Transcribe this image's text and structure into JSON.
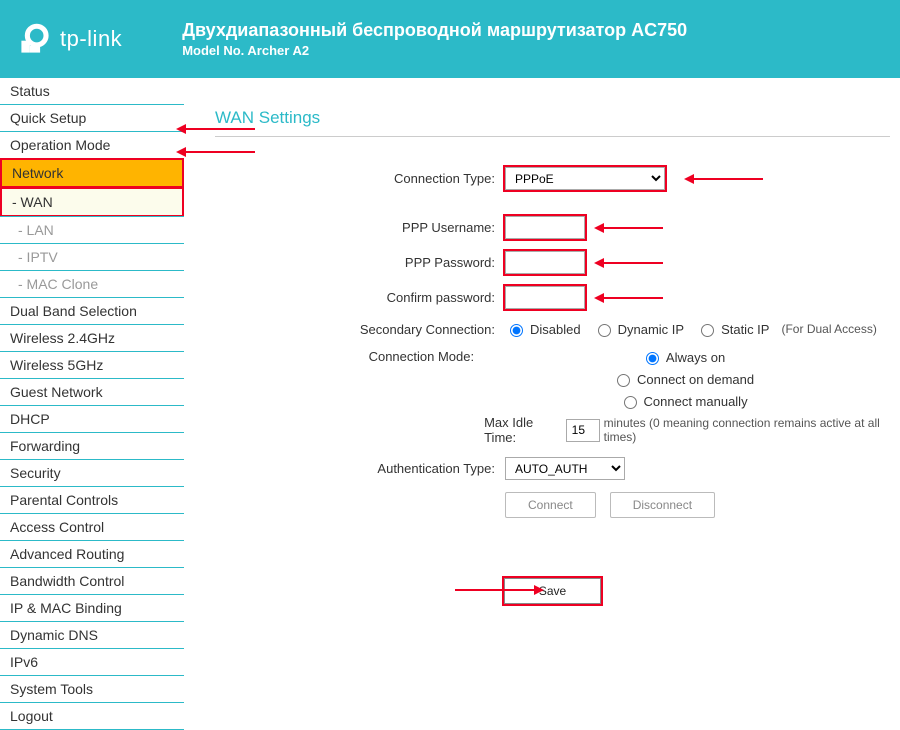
{
  "header": {
    "brand": "tp-link",
    "title": "Двухдиапазонный беспроводной маршрутизатор AC750",
    "subtitle": "Model No. Archer A2"
  },
  "sidebar": {
    "items": [
      {
        "label": "Status"
      },
      {
        "label": "Quick Setup"
      },
      {
        "label": "Operation Mode"
      },
      {
        "label": "Network"
      },
      {
        "label": "- WAN"
      },
      {
        "label": "- LAN"
      },
      {
        "label": "- IPTV"
      },
      {
        "label": "- MAC Clone"
      },
      {
        "label": "Dual Band Selection"
      },
      {
        "label": "Wireless 2.4GHz"
      },
      {
        "label": "Wireless 5GHz"
      },
      {
        "label": "Guest Network"
      },
      {
        "label": "DHCP"
      },
      {
        "label": "Forwarding"
      },
      {
        "label": "Security"
      },
      {
        "label": "Parental Controls"
      },
      {
        "label": "Access Control"
      },
      {
        "label": "Advanced Routing"
      },
      {
        "label": "Bandwidth Control"
      },
      {
        "label": "IP & MAC Binding"
      },
      {
        "label": "Dynamic DNS"
      },
      {
        "label": "IPv6"
      },
      {
        "label": "System Tools"
      },
      {
        "label": "Logout"
      }
    ]
  },
  "page": {
    "title": "WAN Settings",
    "labels": {
      "connection_type": "Connection Type:",
      "ppp_username": "PPP Username:",
      "ppp_password": "PPP Password:",
      "confirm_password": "Confirm password:",
      "secondary_connection": "Secondary Connection:",
      "connection_mode": "Connection Mode:",
      "max_idle": "Max Idle Time:",
      "minutes_note": "minutes (0 meaning connection remains active at all times)",
      "auth_type": "Authentication Type:"
    },
    "values": {
      "connection_type": "PPPoE",
      "ppp_username": "",
      "ppp_password": "",
      "confirm_password": "",
      "max_idle": "15",
      "auth_type": "AUTO_AUTH"
    },
    "secondary_options": {
      "disabled": "Disabled",
      "dynamic": "Dynamic IP",
      "static": "Static IP",
      "trailing": "(For Dual Access)"
    },
    "mode_options": {
      "always": "Always on",
      "demand": "Connect on demand",
      "manual": "Connect manually"
    },
    "buttons": {
      "connect": "Connect",
      "disconnect": "Disconnect",
      "save": "Save"
    }
  }
}
